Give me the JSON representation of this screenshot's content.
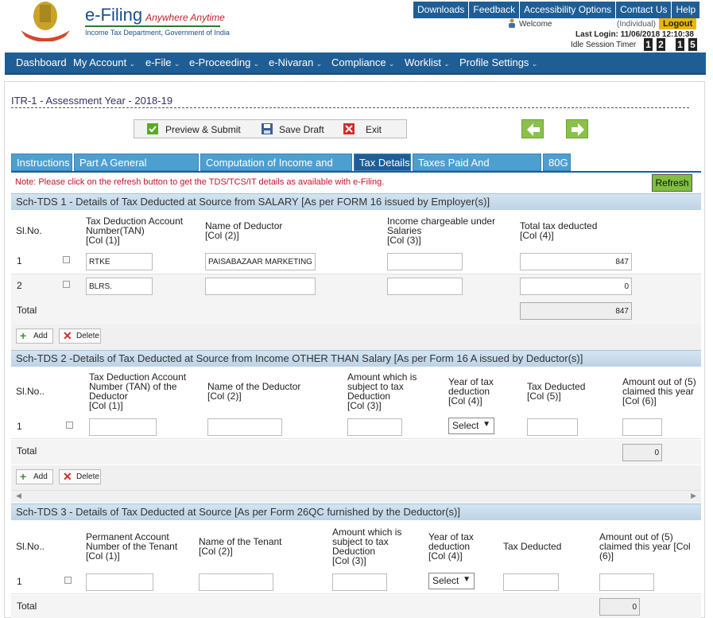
{
  "brand": {
    "title": "e-Filing",
    "tagline": "Anywhere Anytime",
    "subtitle": "Income Tax Department, Government of India"
  },
  "toplinks": [
    "Downloads",
    "Feedback",
    "Accessibility Options",
    "Contact Us",
    "Help"
  ],
  "user": {
    "welcome": "Welcome",
    "type": "(Individual)",
    "logout": "Logout",
    "last_login": "Last Login: 11/06/2018 12:10:38",
    "idle_label": "Idle Session Timer",
    "timer_digits": [
      "1",
      "2",
      "1",
      "5"
    ]
  },
  "nav": [
    "Dashboard",
    "My Account",
    "e-File",
    "e-Proceeding",
    "e-Nivaran",
    "Compliance",
    "Worklist",
    "Profile Settings"
  ],
  "form_title": "ITR-1 - Assessment Year - 2018-19",
  "actions": {
    "preview": "Preview & Submit",
    "save": "Save Draft",
    "exit": "Exit"
  },
  "tabs": [
    "Instructions",
    "Part A General Information",
    "Computation of Income and Tax",
    "Tax Details",
    "Taxes Paid And Verification",
    "80G"
  ],
  "note": "Note: Please click on the refresh button to get the TDS/TCS/IT details as available with e-Filing.",
  "refresh": "Refresh",
  "tds1": {
    "header": "Sch-TDS 1 - Details of Tax Deducted at Source from SALARY [As per FORM 16 issued by Employer(s)]",
    "cols": [
      [
        "Sl.No."
      ],
      [
        "Tax Deduction Account",
        "Number(TAN)",
        "[Col (1)]"
      ],
      [
        "Name of Deductor",
        "[Col (2)]"
      ],
      [
        "Income chargeable under",
        "Salaries",
        "[Col (3)]"
      ],
      [
        "Total tax deducted",
        "[Col (4)]"
      ]
    ],
    "rows": [
      {
        "sl": "1",
        "tan": "RTKE",
        "name": "PAISABAZAAR MARKETING A",
        "income": "",
        "tax": "847"
      },
      {
        "sl": "2",
        "tan": "BLRS.",
        "name": "",
        "income": "",
        "tax": "0"
      }
    ],
    "total_label": "Total",
    "total": "847"
  },
  "tds2": {
    "header": "Sch-TDS 2 -Details of Tax Deducted at Source from Income OTHER THAN Salary [As per Form 16 A issued by Deductor(s)]",
    "cols": [
      [
        "Sl.No.."
      ],
      [
        "Tax Deduction Account",
        "Number (TAN) of the",
        "Deductor",
        "[Col (1)]"
      ],
      [
        "Name of the Deductor",
        "[Col (2)]"
      ],
      [
        "Amount which is",
        "subject to tax",
        "Deduction",
        "[Col (3)]"
      ],
      [
        "Year of tax",
        "deduction",
        "[Col (4)]"
      ],
      [
        "Tax Deducted",
        "[Col (5)]"
      ],
      [
        "Amount out of (5)",
        "claimed this year",
        "[Col (6)]"
      ]
    ],
    "row_sl": "1",
    "select": "Select",
    "total_label": "Total",
    "total": "0"
  },
  "tds3": {
    "header": "Sch-TDS 3 - Details of Tax Deducted at Source [As per Form 26QC furnished by the Deductor(s)]",
    "cols": [
      [
        "Sl.No.."
      ],
      [
        "Permanent Account",
        "Number of the Tenant",
        "[Col (1)]"
      ],
      [
        "Name of the Tenant",
        "[Col (2)]"
      ],
      [
        "Amount which is",
        "subject to tax",
        "Deduction",
        "[Col (3)]"
      ],
      [
        "Year of tax",
        "deduction",
        "[Col (4)]"
      ],
      [
        "Tax Deducted"
      ],
      [
        "Amount out of (5)",
        "claimed this year [Col",
        "(6)]"
      ]
    ],
    "row_sl": "1",
    "select": "Select",
    "total_label": "Total",
    "total": "0"
  },
  "buttons": {
    "add": "Add",
    "delete": "Delete"
  }
}
